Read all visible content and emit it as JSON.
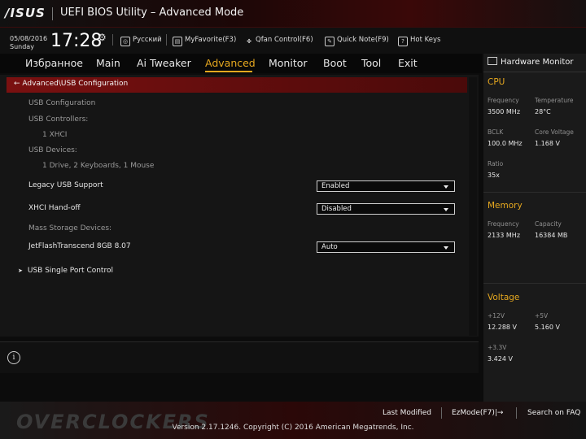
{
  "header": {
    "brand": "/ISUS",
    "title": "UEFI BIOS Utility – Advanced Mode"
  },
  "infobar": {
    "date": "05/08/2016",
    "day": "Sunday",
    "time": "17:28",
    "language": "Русский",
    "myfavorite": "MyFavorite(F3)",
    "qfan": "Qfan Control(F6)",
    "quicknote": "Quick Note(F9)",
    "hotkeys": "Hot Keys"
  },
  "menu": {
    "items": [
      "Избранное",
      "Main",
      "Ai Tweaker",
      "Advanced",
      "Monitor",
      "Boot",
      "Tool",
      "Exit"
    ],
    "active": "Advanced"
  },
  "breadcrumb": "Advanced\\USB Configuration",
  "main": {
    "section_title": "USB Configuration",
    "controllers_label": "USB Controllers:",
    "controllers_value": "1 XHCI",
    "devices_label": "USB Devices:",
    "devices_value": "1 Drive, 2 Keyboards, 1 Mouse",
    "legacy_label": "Legacy USB Support",
    "legacy_value": "Enabled",
    "xhci_label": "XHCI Hand-off",
    "xhci_value": "Disabled",
    "mass_label": "Mass Storage Devices:",
    "jetflash_label": "JetFlashTranscend 8GB 8.07",
    "jetflash_value": "Auto",
    "single_port": "USB Single Port Control"
  },
  "hw": {
    "title": "Hardware Monitor",
    "cpu": {
      "title": "CPU",
      "freq_label": "Frequency",
      "freq_value": "3500 MHz",
      "temp_label": "Temperature",
      "temp_value": "28°C",
      "bclk_label": "BCLK",
      "bclk_value": "100.0 MHz",
      "vcore_label": "Core Voltage",
      "vcore_value": "1.168 V",
      "ratio_label": "Ratio",
      "ratio_value": "35x"
    },
    "memory": {
      "title": "Memory",
      "freq_label": "Frequency",
      "freq_value": "2133 MHz",
      "cap_label": "Capacity",
      "cap_value": "16384 MB"
    },
    "voltage": {
      "title": "Voltage",
      "v12_label": "+12V",
      "v12_value": "12.288 V",
      "v5_label": "+5V",
      "v5_value": "5.160 V",
      "v33_label": "+3.3V",
      "v33_value": "3.424 V"
    }
  },
  "footer": {
    "watermark": "OVERCLOCKERS",
    "last_modified": "Last Modified",
    "ezmode": "EzMode(F7)|→",
    "search": "Search on FAQ",
    "copyright": "Version 2.17.1246. Copyright (C) 2016 American Megatrends, Inc."
  },
  "colors": {
    "accent": "#e6a81f",
    "breadcrumb_bar": "#7a1010"
  }
}
